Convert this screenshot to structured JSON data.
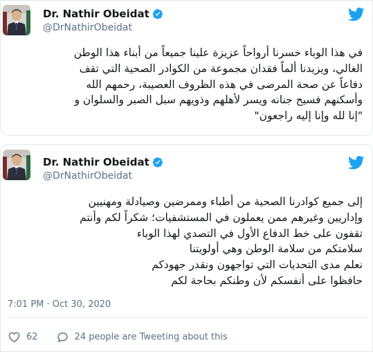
{
  "tweets": [
    {
      "author": {
        "name": "Dr. Nathir Obeidat",
        "handle": "@DrNathirObeidat",
        "verified": true
      },
      "lines": [
        "في هذا الوباء خسرنا أرواحاً عزيزة علينا جميعاً من أبناء هذا الوطن",
        "الغالي، ويزيدنا ألماً فقدان مجموعة من الكوادر الصحية التي تقف",
        "دفاعاً عن صحة المرضى في هذه الظروف العصيبة، رحمهم الله",
        "وأسكنهم فسيح جنانه ويسر لأهلهم وذويهم سبل الصبر والسلوان و",
        "\"إنا لله وإنا إليه راجعون\""
      ]
    },
    {
      "author": {
        "name": "Dr. Nathir Obeidat",
        "handle": "@DrNathirObeidat",
        "verified": true
      },
      "lines": [
        "إلى جميع كوادرنا الصحية من أطباء وممرضين وصيادلة ومهنيين",
        "وإداريين وغيرهم ممن يعملون في المستشفيات؛ شكراً لكم وأنتم",
        "تقفون على خط الدفاع الأول في التصدي لهذا الوباء",
        "سلامتكم من سلامة الوطن وهي أولويتنا",
        "نعلم مدى التحديات التي تواجهون ونقدر جهودكم",
        "حافظوا على أنفسكم لأن وطنكم بحاجة لكم"
      ],
      "timestamp": "7:01 PM · Oct 30, 2020",
      "likes": "62",
      "tweeting_about": "24 people are Tweeting about this"
    }
  ],
  "icons": {
    "verified": "verified-badge-icon",
    "platform": "twitter-bird-icon",
    "like": "heart-icon",
    "reply": "speech-bubble-icon"
  },
  "colors": {
    "brand_blue": "#1da1f2",
    "secondary_text": "#5b7083",
    "primary_text": "#14171a",
    "border": "#e1e8ed"
  }
}
